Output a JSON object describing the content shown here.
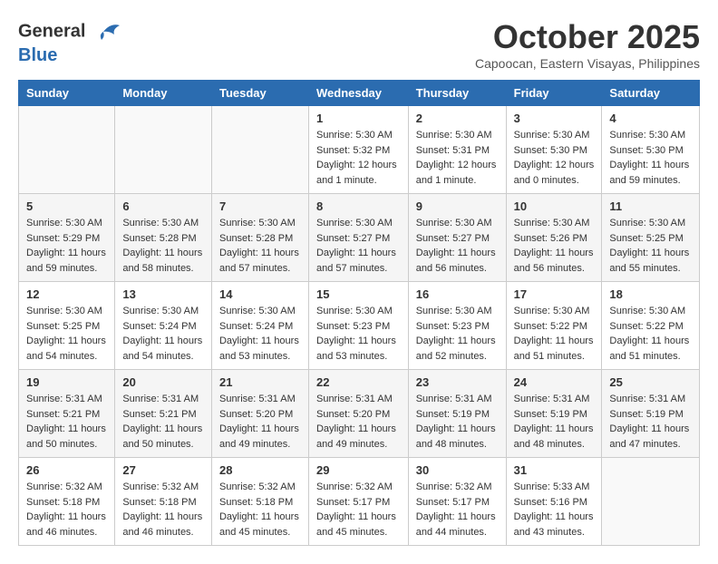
{
  "header": {
    "logo_line1": "General",
    "logo_line2": "Blue",
    "month": "October 2025",
    "location": "Capoocan, Eastern Visayas, Philippines"
  },
  "days_of_week": [
    "Sunday",
    "Monday",
    "Tuesday",
    "Wednesday",
    "Thursday",
    "Friday",
    "Saturday"
  ],
  "weeks": [
    [
      {
        "day": "",
        "info": ""
      },
      {
        "day": "",
        "info": ""
      },
      {
        "day": "",
        "info": ""
      },
      {
        "day": "1",
        "info": "Sunrise: 5:30 AM\nSunset: 5:32 PM\nDaylight: 12 hours\nand 1 minute."
      },
      {
        "day": "2",
        "info": "Sunrise: 5:30 AM\nSunset: 5:31 PM\nDaylight: 12 hours\nand 1 minute."
      },
      {
        "day": "3",
        "info": "Sunrise: 5:30 AM\nSunset: 5:30 PM\nDaylight: 12 hours\nand 0 minutes."
      },
      {
        "day": "4",
        "info": "Sunrise: 5:30 AM\nSunset: 5:30 PM\nDaylight: 11 hours\nand 59 minutes."
      }
    ],
    [
      {
        "day": "5",
        "info": "Sunrise: 5:30 AM\nSunset: 5:29 PM\nDaylight: 11 hours\nand 59 minutes."
      },
      {
        "day": "6",
        "info": "Sunrise: 5:30 AM\nSunset: 5:28 PM\nDaylight: 11 hours\nand 58 minutes."
      },
      {
        "day": "7",
        "info": "Sunrise: 5:30 AM\nSunset: 5:28 PM\nDaylight: 11 hours\nand 57 minutes."
      },
      {
        "day": "8",
        "info": "Sunrise: 5:30 AM\nSunset: 5:27 PM\nDaylight: 11 hours\nand 57 minutes."
      },
      {
        "day": "9",
        "info": "Sunrise: 5:30 AM\nSunset: 5:27 PM\nDaylight: 11 hours\nand 56 minutes."
      },
      {
        "day": "10",
        "info": "Sunrise: 5:30 AM\nSunset: 5:26 PM\nDaylight: 11 hours\nand 56 minutes."
      },
      {
        "day": "11",
        "info": "Sunrise: 5:30 AM\nSunset: 5:25 PM\nDaylight: 11 hours\nand 55 minutes."
      }
    ],
    [
      {
        "day": "12",
        "info": "Sunrise: 5:30 AM\nSunset: 5:25 PM\nDaylight: 11 hours\nand 54 minutes."
      },
      {
        "day": "13",
        "info": "Sunrise: 5:30 AM\nSunset: 5:24 PM\nDaylight: 11 hours\nand 54 minutes."
      },
      {
        "day": "14",
        "info": "Sunrise: 5:30 AM\nSunset: 5:24 PM\nDaylight: 11 hours\nand 53 minutes."
      },
      {
        "day": "15",
        "info": "Sunrise: 5:30 AM\nSunset: 5:23 PM\nDaylight: 11 hours\nand 53 minutes."
      },
      {
        "day": "16",
        "info": "Sunrise: 5:30 AM\nSunset: 5:23 PM\nDaylight: 11 hours\nand 52 minutes."
      },
      {
        "day": "17",
        "info": "Sunrise: 5:30 AM\nSunset: 5:22 PM\nDaylight: 11 hours\nand 51 minutes."
      },
      {
        "day": "18",
        "info": "Sunrise: 5:30 AM\nSunset: 5:22 PM\nDaylight: 11 hours\nand 51 minutes."
      }
    ],
    [
      {
        "day": "19",
        "info": "Sunrise: 5:31 AM\nSunset: 5:21 PM\nDaylight: 11 hours\nand 50 minutes."
      },
      {
        "day": "20",
        "info": "Sunrise: 5:31 AM\nSunset: 5:21 PM\nDaylight: 11 hours\nand 50 minutes."
      },
      {
        "day": "21",
        "info": "Sunrise: 5:31 AM\nSunset: 5:20 PM\nDaylight: 11 hours\nand 49 minutes."
      },
      {
        "day": "22",
        "info": "Sunrise: 5:31 AM\nSunset: 5:20 PM\nDaylight: 11 hours\nand 49 minutes."
      },
      {
        "day": "23",
        "info": "Sunrise: 5:31 AM\nSunset: 5:19 PM\nDaylight: 11 hours\nand 48 minutes."
      },
      {
        "day": "24",
        "info": "Sunrise: 5:31 AM\nSunset: 5:19 PM\nDaylight: 11 hours\nand 48 minutes."
      },
      {
        "day": "25",
        "info": "Sunrise: 5:31 AM\nSunset: 5:19 PM\nDaylight: 11 hours\nand 47 minutes."
      }
    ],
    [
      {
        "day": "26",
        "info": "Sunrise: 5:32 AM\nSunset: 5:18 PM\nDaylight: 11 hours\nand 46 minutes."
      },
      {
        "day": "27",
        "info": "Sunrise: 5:32 AM\nSunset: 5:18 PM\nDaylight: 11 hours\nand 46 minutes."
      },
      {
        "day": "28",
        "info": "Sunrise: 5:32 AM\nSunset: 5:18 PM\nDaylight: 11 hours\nand 45 minutes."
      },
      {
        "day": "29",
        "info": "Sunrise: 5:32 AM\nSunset: 5:17 PM\nDaylight: 11 hours\nand 45 minutes."
      },
      {
        "day": "30",
        "info": "Sunrise: 5:32 AM\nSunset: 5:17 PM\nDaylight: 11 hours\nand 44 minutes."
      },
      {
        "day": "31",
        "info": "Sunrise: 5:33 AM\nSunset: 5:16 PM\nDaylight: 11 hours\nand 43 minutes."
      },
      {
        "day": "",
        "info": ""
      }
    ]
  ]
}
